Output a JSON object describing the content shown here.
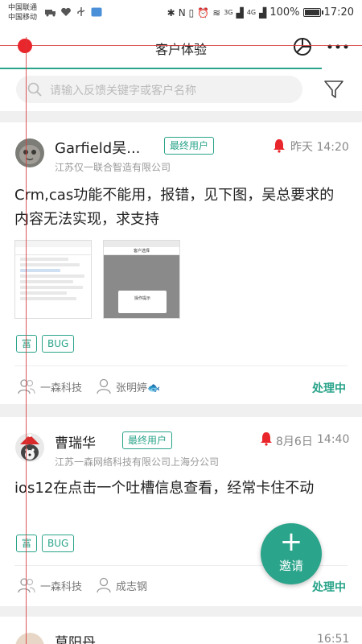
{
  "status_bar": {
    "carrier_1": "中国联通",
    "carrier_2": "中国移动",
    "battery_text": "100%",
    "battery_level": 1.0,
    "time": "17:20",
    "signal_1": "3G",
    "signal_2": "4G"
  },
  "header": {
    "title": "客户体验"
  },
  "search": {
    "placeholder": "请输入反馈关键字或客户名称"
  },
  "colors": {
    "accent": "#2aa48a",
    "alert": "#e8262c"
  },
  "fab": {
    "plus": "+",
    "label": "邀请"
  },
  "cards": [
    {
      "name": "Garfield吴...",
      "role": "最终用户",
      "company": "江苏仅一联合智造有限公司",
      "time": "昨天 14:20",
      "content": "Crm,cas功能不能用，报错，见下图，吴总要求的内容无法实现，求支持",
      "tags": [
        "富",
        "BUG"
      ],
      "org": "一森科技",
      "assignee": "张明婷🐟",
      "status": "处理中",
      "thumb2_title": "客户选择",
      "thumb2_dialog": "操作提示"
    },
    {
      "name": "曹瑞华",
      "role": "最终用户",
      "company": "江苏一森网络科技有限公司上海分公司",
      "date": "8月6日",
      "clock": "14:40",
      "content": "ios12在点击一个吐槽信息查看，经常卡住不动",
      "tags": [
        "富",
        "BUG"
      ],
      "org": "一森科技",
      "assignee": "成志钢",
      "status": "处理中"
    },
    {
      "name": "莫阳丹",
      "time": "16:51"
    }
  ]
}
